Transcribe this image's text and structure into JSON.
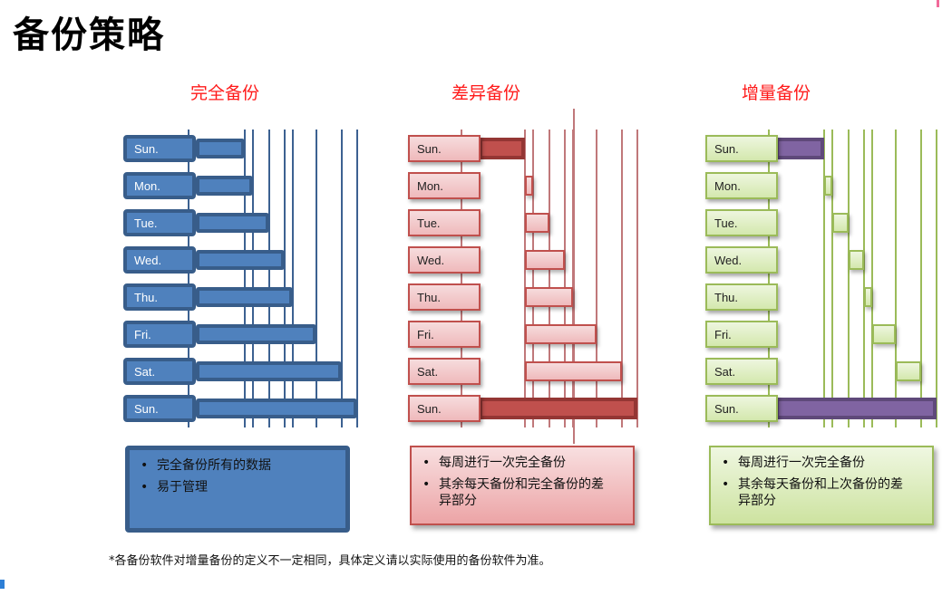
{
  "title": "备份策略",
  "panels": [
    {
      "key": "full",
      "title": "完全备份",
      "days": [
        "Sun.",
        "Mon.",
        "Tue.",
        "Wed.",
        "Thu.",
        "Fri.",
        "Sat.",
        "Sun."
      ],
      "notes": [
        "完全备份所有的数据",
        "易于管理"
      ]
    },
    {
      "key": "diff",
      "title": "差异备份",
      "days": [
        "Sun.",
        "Mon.",
        "Tue.",
        "Wed.",
        "Thu.",
        "Fri.",
        "Sat.",
        "Sun."
      ],
      "notes": [
        "每周进行一次完全备份",
        "其余每天备份和完全备份的差异部分"
      ]
    },
    {
      "key": "inc",
      "title": "增量备份",
      "days": [
        "Sun.",
        "Mon.",
        "Tue.",
        "Wed.",
        "Thu.",
        "Fri.",
        "Sat.",
        "Sun."
      ],
      "notes": [
        "每周进行一次完全备份",
        "其余每天备份和上次备份的差异部分"
      ]
    }
  ],
  "chart_data": {
    "type": "bar",
    "description": "Backup data volume per day (cumulative data units) for three backup strategies",
    "data_change_boundaries": [
      0,
      63,
      72,
      90,
      106,
      115,
      141,
      168,
      185
    ],
    "series": [
      {
        "name": "完全备份",
        "bars": [
          [
            0,
            63
          ],
          [
            0,
            72
          ],
          [
            0,
            90
          ],
          [
            0,
            106
          ],
          [
            0,
            115
          ],
          [
            0,
            141
          ],
          [
            0,
            168
          ],
          [
            0,
            185
          ]
        ],
        "full_backup_days": [
          0,
          1,
          2,
          3,
          4,
          5,
          6,
          7
        ]
      },
      {
        "name": "差异备份",
        "bars": [
          [
            0,
            63
          ],
          [
            63,
            72
          ],
          [
            63,
            90
          ],
          [
            63,
            106
          ],
          [
            63,
            115
          ],
          [
            63,
            141
          ],
          [
            63,
            168
          ],
          [
            0,
            185
          ]
        ],
        "full_backup_days": [
          0,
          7
        ]
      },
      {
        "name": "增量备份",
        "bars": [
          [
            0,
            63
          ],
          [
            63,
            72
          ],
          [
            72,
            90
          ],
          [
            90,
            106
          ],
          [
            106,
            115
          ],
          [
            115,
            141
          ],
          [
            141,
            168
          ],
          [
            0,
            185
          ]
        ],
        "full_backup_days": [
          0,
          7
        ]
      }
    ],
    "colors": {
      "full": "#4f81bd",
      "diff_full": "#c0504d",
      "diff_partial": "#f2c4c5",
      "inc_full": "#8064a2",
      "inc_partial": "#dcecbf"
    }
  },
  "footnote": "*各备份软件对增量备份的定义不一定相同，具体定义请以实际使用的备份软件为准。"
}
